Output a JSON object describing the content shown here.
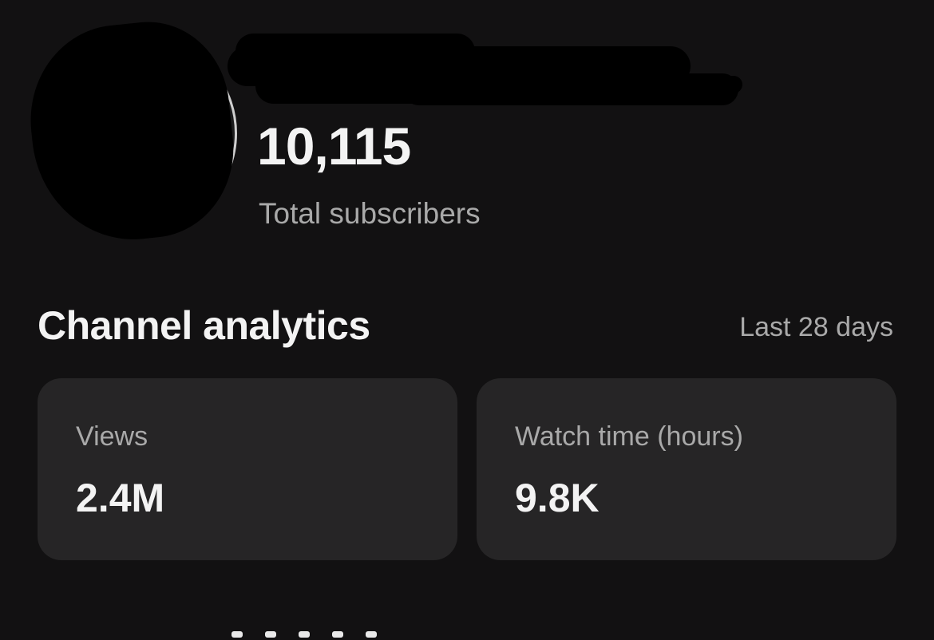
{
  "header": {
    "subscriber_count": "10,115",
    "subscriber_label": "Total subscribers"
  },
  "analytics": {
    "title": "Channel analytics",
    "period": "Last 28 days",
    "cards": [
      {
        "label": "Views",
        "value": "2.4M"
      },
      {
        "label": "Watch time (hours)",
        "value": "9.8K"
      }
    ]
  },
  "colors": {
    "background": "#121112",
    "card": "#262526",
    "primary_text": "#f3f3f3",
    "secondary_text": "#a9a9a9"
  }
}
